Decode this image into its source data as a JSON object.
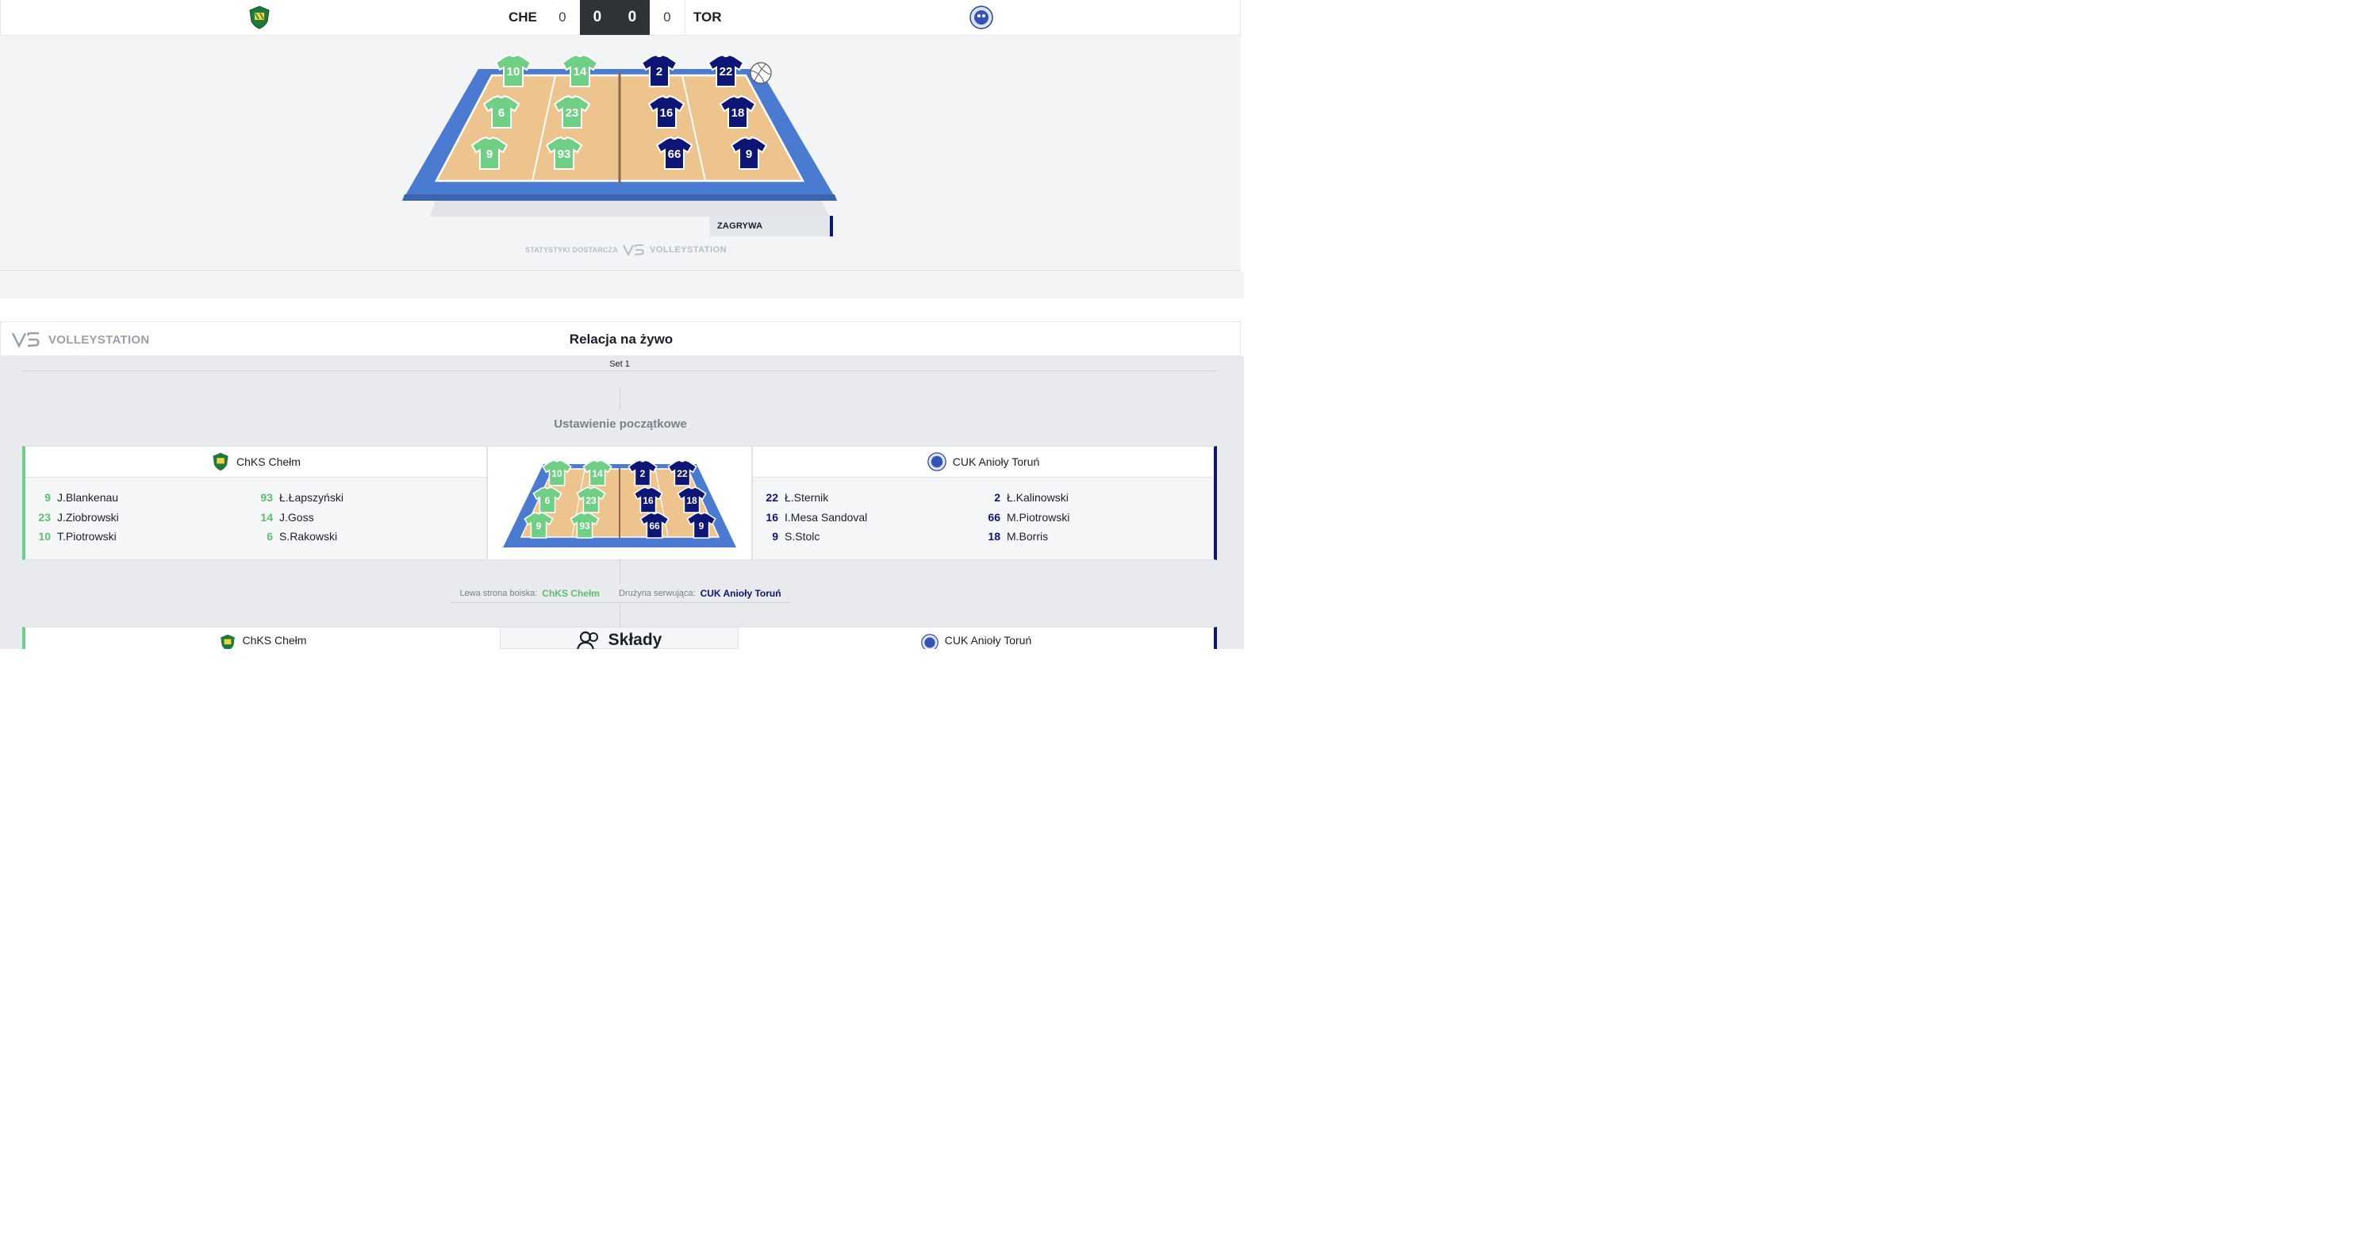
{
  "scoreboard": {
    "home_abbr": "CHE",
    "away_abbr": "TOR",
    "home_sets": "0",
    "home_points": "0",
    "away_points": "0",
    "away_sets": "0",
    "home_logo": "chks-chelm-logo",
    "away_logo": "aniolly-torun-logo"
  },
  "court": {
    "home_players": [
      "10",
      "14",
      "6",
      "23",
      "9",
      "93"
    ],
    "away_players": [
      "2",
      "22",
      "16",
      "18",
      "66",
      "9"
    ],
    "serving_label": "ZAGRYWA",
    "ball_icon": "volleyball-icon"
  },
  "provider": {
    "label": "STATYSTYKI DOSTARCZA",
    "name": "VOLLEYSTATION"
  },
  "live": {
    "brand": "VOLLEYSTATION",
    "title": "Relacja na żywo",
    "set_label": "Set 1",
    "setup_title": "Ustawienie początkowe"
  },
  "home_team": {
    "name": "ChKS Chełm",
    "color": "#6fcf84",
    "players": [
      {
        "num": "9",
        "name": "J.Blankenau"
      },
      {
        "num": "23",
        "name": "J.Ziobrowski"
      },
      {
        "num": "10",
        "name": "T.Piotrowski"
      },
      {
        "num": "93",
        "name": "Ł.Łapszyński"
      },
      {
        "num": "14",
        "name": "J.Goss"
      },
      {
        "num": "6",
        "name": "S.Rakowski"
      }
    ]
  },
  "away_team": {
    "name": "CUK Anioły Toruń",
    "color": "#0d1575",
    "players": [
      {
        "num": "22",
        "name": "Ł.Sternik"
      },
      {
        "num": "16",
        "name": "I.Mesa Sandoval"
      },
      {
        "num": "9",
        "name": "S.Stolc"
      },
      {
        "num": "2",
        "name": "Ł.Kalinowski"
      },
      {
        "num": "66",
        "name": "M.Piotrowski"
      },
      {
        "num": "18",
        "name": "M.Borris"
      }
    ]
  },
  "info": {
    "left_side_label": "Lewa strona boiska:",
    "left_side_team": "ChKS Chełm",
    "serving_label": "Drużyna serwująca:",
    "serving_team": "CUK Anioły Toruń"
  },
  "bottom": {
    "home_name": "ChKS Chełm",
    "squads_label": "Składy",
    "away_name": "CUK Anioły Toruń",
    "squads_icon": "people-icon"
  }
}
